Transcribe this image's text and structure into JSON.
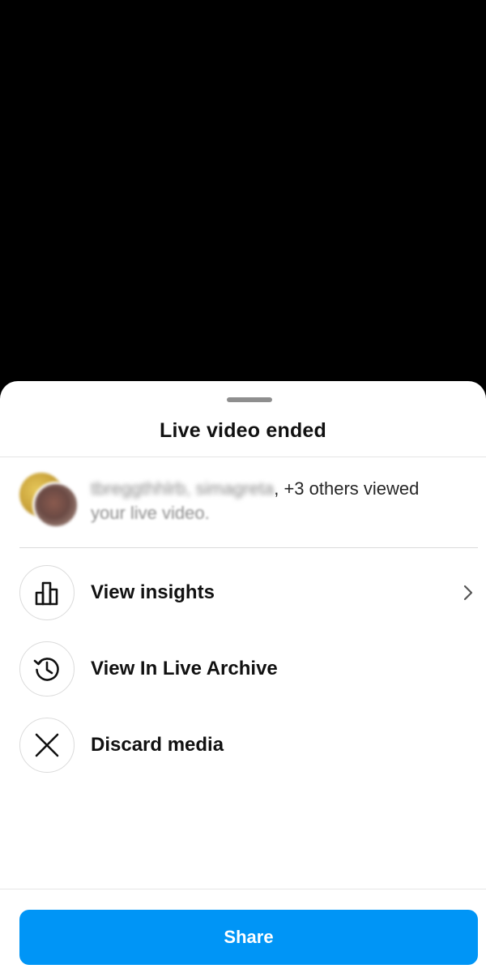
{
  "sheet": {
    "title": "Live video ended"
  },
  "viewers": {
    "names_blurred": "tbreggthhlrb, simagreta",
    "others_text": ", +3 others viewed",
    "tail_text": "your live video."
  },
  "actions": [
    {
      "label": "View insights",
      "icon": "bar-chart-icon",
      "has_chevron": true
    },
    {
      "label": "View In Live Archive",
      "icon": "history-clock-icon",
      "has_chevron": false
    },
    {
      "label": "Discard media",
      "icon": "close-icon",
      "has_chevron": false
    }
  ],
  "footer": {
    "share_label": "Share"
  },
  "colors": {
    "accent": "#0095f6",
    "background_video": "#000000",
    "sheet": "#ffffff"
  }
}
